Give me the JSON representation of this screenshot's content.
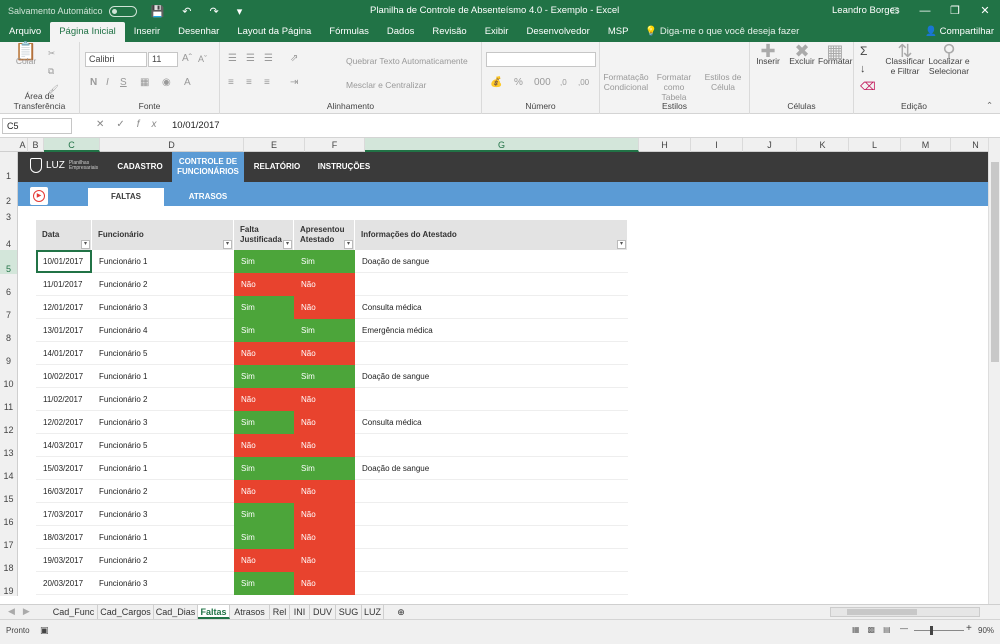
{
  "titlebar": {
    "autosave": "Salvamento Automático",
    "title": "Planilha de Controle de Absenteísmo 4.0 - Exemplo  -  Excel",
    "user": "Leandro Borges"
  },
  "menu": {
    "tabs": [
      "Arquivo",
      "Página Inicial",
      "Inserir",
      "Desenhar",
      "Layout da Página",
      "Fórmulas",
      "Dados",
      "Revisão",
      "Exibir",
      "Desenvolvedor",
      "MSP"
    ],
    "active": "Página Inicial",
    "tellme": "Diga-me o que você deseja fazer",
    "share": "Compartilhar"
  },
  "ribbon": {
    "clipboard": {
      "paste": "Colar",
      "label": "Área de Transferência"
    },
    "font": {
      "name": "Calibri",
      "size": "11",
      "bold": "N",
      "italic": "I",
      "underline": "S",
      "label": "Fonte"
    },
    "alignment": {
      "wrap": "Quebrar Texto Automaticamente",
      "merge": "Mesclar e Centralizar",
      "label": "Alinhamento"
    },
    "number": {
      "label": "Número"
    },
    "styles": {
      "conditional": "Formatação Condicional",
      "table": "Formatar como Tabela",
      "cell": "Estilos de Célula",
      "label": "Estilos"
    },
    "cells": {
      "insert": "Inserir",
      "delete": "Excluir",
      "format": "Formatar",
      "label": "Células"
    },
    "editing": {
      "sort": "Classificar e Filtrar",
      "find": "Localizar e Selecionar",
      "label": "Edição"
    }
  },
  "formula": {
    "namebox": "C5",
    "value": "10/01/2017"
  },
  "columns": [
    "A",
    "B",
    "C",
    "D",
    "E",
    "F",
    "G",
    "H",
    "I",
    "J",
    "K",
    "L",
    "M",
    "N"
  ],
  "rows": [
    "1",
    "2",
    "3",
    "4",
    "5",
    "6",
    "7",
    "8",
    "9",
    "10",
    "11",
    "12",
    "13",
    "14",
    "15",
    "16",
    "17",
    "18",
    "19"
  ],
  "nav": {
    "logo": "LUZ",
    "logo_sub": "Planilhas Empresariais",
    "items": [
      "CADASTRO",
      "CONTROLE DE FUNCIONÁRIOS",
      "RELATÓRIO",
      "INSTRUÇÕES"
    ],
    "active": "CONTROLE DE FUNCIONÁRIOS"
  },
  "subtabs": {
    "items": [
      "FALTAS",
      "ATRASOS"
    ],
    "active": "FALTAS"
  },
  "table": {
    "headers": [
      "Data",
      "Funcionário",
      "Falta Justificada",
      "Apresentou Atestado",
      "Informações do Atestado"
    ],
    "rows": [
      [
        "10/01/2017",
        "Funcionário 1",
        "Sim",
        "Sim",
        "Doação de sangue"
      ],
      [
        "11/01/2017",
        "Funcionário 2",
        "Não",
        "Não",
        ""
      ],
      [
        "12/01/2017",
        "Funcionário 3",
        "Sim",
        "Não",
        "Consulta médica"
      ],
      [
        "13/01/2017",
        "Funcionário 4",
        "Sim",
        "Sim",
        "Emergência médica"
      ],
      [
        "14/01/2017",
        "Funcionário 5",
        "Não",
        "Não",
        ""
      ],
      [
        "10/02/2017",
        "Funcionário 1",
        "Sim",
        "Sim",
        "Doação de sangue"
      ],
      [
        "11/02/2017",
        "Funcionário 2",
        "Não",
        "Não",
        ""
      ],
      [
        "12/02/2017",
        "Funcionário 3",
        "Sim",
        "Não",
        "Consulta médica"
      ],
      [
        "14/03/2017",
        "Funcionário 5",
        "Não",
        "Não",
        ""
      ],
      [
        "15/03/2017",
        "Funcionário 1",
        "Sim",
        "Sim",
        "Doação de sangue"
      ],
      [
        "16/03/2017",
        "Funcionário 2",
        "Não",
        "Não",
        ""
      ],
      [
        "17/03/2017",
        "Funcionário 3",
        "Sim",
        "Não",
        ""
      ],
      [
        "18/03/2017",
        "Funcionário 1",
        "Sim",
        "Não",
        ""
      ],
      [
        "19/03/2017",
        "Funcionário 2",
        "Não",
        "Não",
        ""
      ],
      [
        "20/03/2017",
        "Funcionário 3",
        "Sim",
        "Não",
        ""
      ]
    ]
  },
  "sheets": {
    "tabs": [
      "Cad_Func",
      "Cad_Cargos",
      "Cad_Dias",
      "Faltas",
      "Atrasos",
      "Rel",
      "INI",
      "DUV",
      "SUG",
      "LUZ"
    ],
    "active": "Faltas"
  },
  "status": {
    "ready": "Pronto",
    "zoom": "90%"
  },
  "colors": {
    "excel_green": "#217346",
    "sim": "#4ca53a",
    "nao": "#e8432e",
    "nav_dark": "#3a3a3a",
    "nav_blue": "#5b9bd5"
  }
}
